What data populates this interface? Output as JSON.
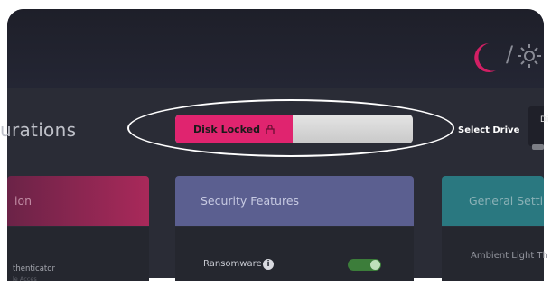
{
  "header": {
    "theme_separator": "/"
  },
  "page": {
    "heading": "urations"
  },
  "disk_toggle": {
    "label": "Disk Locked",
    "state": "locked",
    "accent": "#e0246f"
  },
  "drive": {
    "label": "Select Drive",
    "value": "Di"
  },
  "cards": [
    {
      "title": "ion",
      "color": "#a9295a"
    },
    {
      "title": "Security Features",
      "color": "#5b5f90"
    },
    {
      "title": "General Setti",
      "color": "#2a7880"
    }
  ],
  "card1": {
    "item_label": "thenticator",
    "item_sub": "le Acces"
  },
  "card2": {
    "item_label": "Ransomware",
    "info_glyph": "i",
    "switch_on": true
  },
  "card3": {
    "item_label": "Ambient Light Th"
  }
}
